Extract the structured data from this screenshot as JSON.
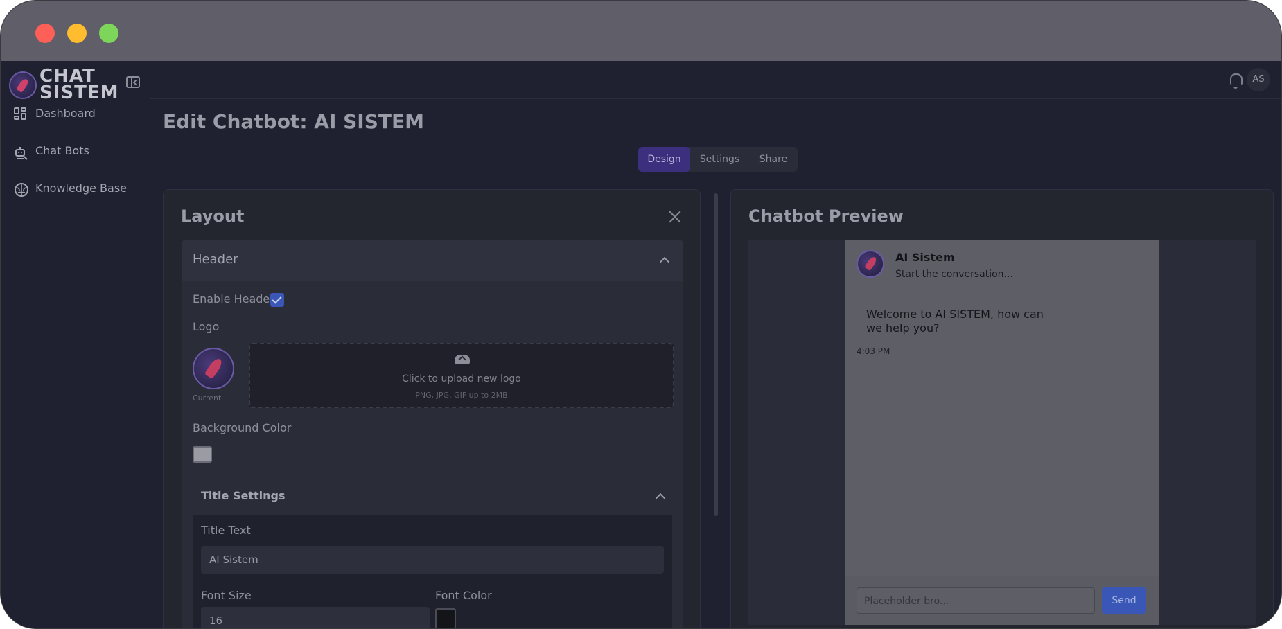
{
  "brand": {
    "name_line1": "CHAT",
    "name_line2": "SISTEM"
  },
  "sidebar": {
    "items": [
      {
        "label": "Dashboard",
        "icon": "dashboard-icon"
      },
      {
        "label": "Chat Bots",
        "icon": "robot-icon"
      },
      {
        "label": "Knowledge Base",
        "icon": "brain-icon"
      }
    ]
  },
  "topbar": {
    "avatar_initials": "AS",
    "icon": "bell-icon"
  },
  "page": {
    "title": "Edit Chatbot: AI SISTEM"
  },
  "tabs": [
    {
      "label": "Design",
      "active": true
    },
    {
      "label": "Settings",
      "active": false
    },
    {
      "label": "Share",
      "active": false
    }
  ],
  "layout_panel": {
    "title": "Layout",
    "header_section": {
      "label": "Header",
      "enable_header_label": "Enable Header",
      "enable_header_checked": true,
      "logo_label": "Logo",
      "current_label": "Current",
      "upload_text": "Click to upload new logo",
      "upload_hint": "PNG, JPG, GIF up to 2MB",
      "background_color_label": "Background Color",
      "background_color": "#9b9ba3"
    },
    "title_settings": {
      "label": "Title Settings",
      "title_text_label": "Title Text",
      "title_text_value": "AI Sistem",
      "font_size_label": "Font Size",
      "font_size_value": "16",
      "font_color_label": "Font Color",
      "font_color": "#141518"
    }
  },
  "preview_panel": {
    "title": "Chatbot Preview",
    "chat": {
      "title": "AI Sistem",
      "subtitle": "Start the conversation...",
      "welcome_message": "Welcome to AI SISTEM, how can we help you?",
      "time": "4:03 PM",
      "input_placeholder": "Placeholder bro...",
      "send_label": "Send"
    }
  },
  "colors": {
    "accent": "#3c2f7e",
    "send_button": "#3a57b8"
  }
}
